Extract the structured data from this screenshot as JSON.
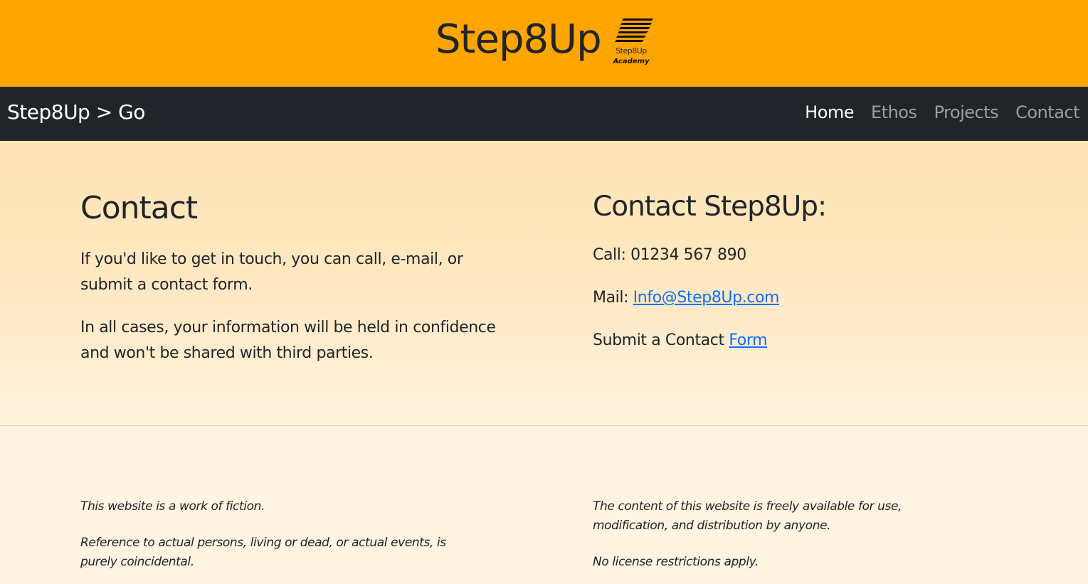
{
  "header": {
    "site_title": "Step8Up",
    "logo": {
      "icon": "stairs-icon",
      "line1": "Step8Up",
      "line2": "Academy"
    },
    "colors": {
      "banner": "#ffa500",
      "navbar": "#212529",
      "link": "#0d6efd"
    }
  },
  "navbar": {
    "brand": "Step8Up > Go",
    "links": [
      {
        "label": "Home",
        "active": true
      },
      {
        "label": "Ethos",
        "active": false
      },
      {
        "label": "Projects",
        "active": false
      },
      {
        "label": "Contact",
        "active": false
      }
    ]
  },
  "main": {
    "left": {
      "heading": "Contact",
      "paragraphs": [
        "If you'd like to get in touch, you can call, e-mail, or submit a contact form.",
        "In all cases, your information will be held in confidence and won't be shared with third parties."
      ]
    },
    "right": {
      "heading": "Contact Step8Up:",
      "call_label": "Call: 01234 567 890",
      "mail_label": "Mail: ",
      "mail_link": "Info@Step8Up.com",
      "form_label": "Submit a Contact ",
      "form_link": "Form"
    }
  },
  "footer": {
    "left": [
      "This website is a work of fiction.",
      "Reference to actual persons, living or dead, or actual events, is purely coincidental."
    ],
    "right": [
      "The content of this website is freely available for use, modification, and distribution by anyone.",
      "No license restrictions apply."
    ]
  }
}
